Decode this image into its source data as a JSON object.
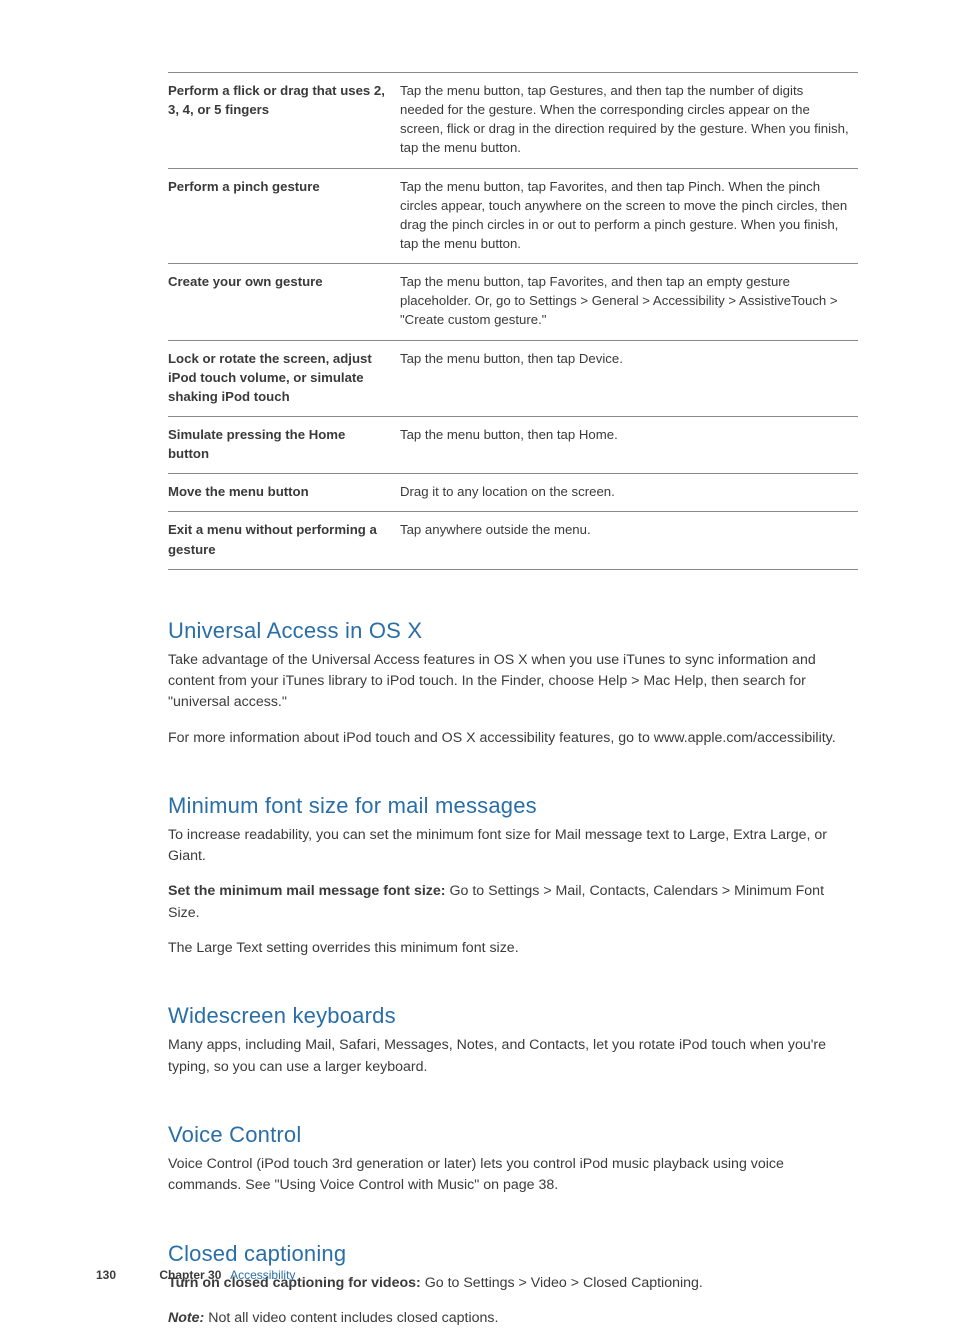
{
  "table": {
    "rows": [
      {
        "left": "Perform a flick or drag that uses 2, 3, 4, or 5 fingers",
        "right": "Tap the menu button, tap Gestures, and then tap the number of digits needed for the gesture. When the corresponding circles appear on the screen, flick or drag in the direction required by the gesture. When you finish, tap the menu button."
      },
      {
        "left": "Perform a pinch gesture",
        "right": "Tap the menu button, tap Favorites, and then tap Pinch. When the pinch circles appear, touch anywhere on the screen to move the pinch circles, then drag the pinch circles in or out to perform a pinch gesture. When you finish, tap the menu button."
      },
      {
        "left": "Create your own gesture",
        "right": "Tap the menu button, tap Favorites, and then tap an empty gesture placeholder. Or, go to Settings > General > Accessibility > AssistiveTouch > \"Create custom gesture.\""
      },
      {
        "left": "Lock or rotate the screen, adjust iPod touch volume, or simulate shaking iPod touch",
        "right": "Tap the menu button, then tap Device."
      },
      {
        "left": "Simulate pressing the Home button",
        "right": "Tap the menu button, then tap Home."
      },
      {
        "left": "Move the menu button",
        "right": "Drag it to any location on the screen."
      },
      {
        "left": "Exit a menu without performing a gesture",
        "right": "Tap anywhere outside the menu."
      }
    ]
  },
  "sections": {
    "universal": {
      "heading": "Universal Access in OS X",
      "p1": "Take advantage of the Universal Access features in OS X when you use iTunes to sync information and content from your iTunes library to iPod touch. In the Finder, choose Help > Mac Help, then search for \"universal access.\"",
      "p2": "For more information about iPod touch and OS X accessibility features, go to www.apple.com/accessibility."
    },
    "minfont": {
      "heading": "Minimum font size for mail messages",
      "p1": "To increase readability, you can set the minimum font size for Mail message text to Large, Extra Large, or Giant.",
      "p2_bold": "Set the minimum mail message font size:  ",
      "p2_rest": "Go to Settings > Mail, Contacts, Calendars > Minimum Font Size.",
      "p3": "The Large Text setting overrides this minimum font size."
    },
    "widescreen": {
      "heading": "Widescreen keyboards",
      "p1": "Many apps, including Mail, Safari, Messages, Notes, and Contacts, let you rotate iPod touch when you're typing, so you can use a larger keyboard."
    },
    "voice": {
      "heading": "Voice Control",
      "p1": "Voice Control (iPod touch 3rd generation or later) lets you control iPod music playback using voice commands. See \"Using Voice Control with Music\" on page 38."
    },
    "cc": {
      "heading": "Closed captioning",
      "p1_bold": "Turn on closed captioning for videos:  ",
      "p1_rest": "Go to Settings > Video > Closed Captioning.",
      "p2_ital": "Note:  ",
      "p2_rest": "Not all video content includes closed captions."
    }
  },
  "footer": {
    "page": "130",
    "chapter": "Chapter 30",
    "chname": "Accessibility"
  }
}
